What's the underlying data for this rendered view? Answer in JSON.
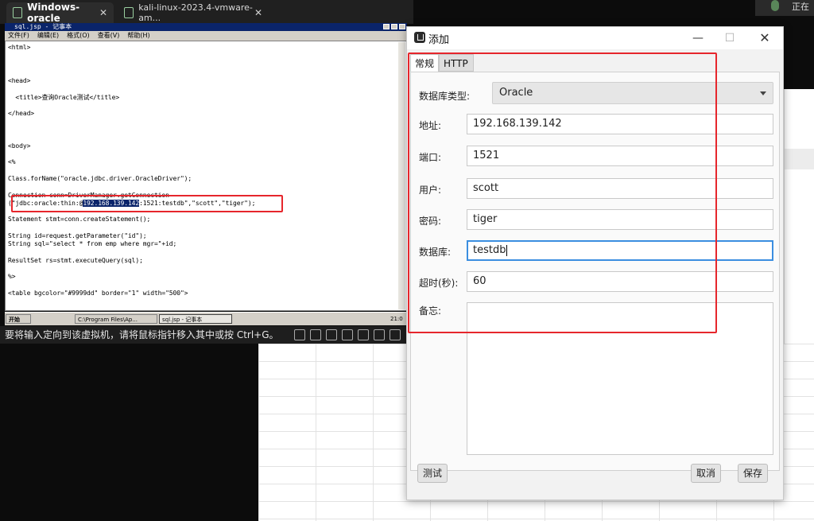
{
  "vm": {
    "tabs": [
      {
        "label": "Windows-oracle",
        "close": "✕"
      },
      {
        "label": "kali-linux-2023.4-vmware-am...",
        "close": "✕"
      }
    ],
    "status_text": "要将输入定向到该虚拟机，请将鼠标指针移入其中或按 Ctrl+G。",
    "top_right_text": "正在"
  },
  "notepad": {
    "title": "sql.jsp - 记事本",
    "menu": [
      "文件(F)",
      "编辑(E)",
      "格式(O)",
      "查看(V)",
      "帮助(H)"
    ],
    "lines": {
      "l1": "<html>",
      "l2": "<head>",
      "l3": "  <title>查询Oracle测试</title>",
      "l4": "</head>",
      "l5": "<body>",
      "l6": "<%",
      "l7": "Class.forName(\"oracle.jdbc.driver.OracleDriver\");",
      "l8": "Connection conn=DriverManager.getConnection",
      "l9a": "(\"jdbc:oracle:thin:@",
      "l9b": "192.168.139.142",
      "l9c": ":1521:testdb\",\"scott\",\"tiger\");",
      "l10": "Statement stmt=conn.createStatement();",
      "l11": "String id=request.getParameter(\"id\");",
      "l12": "String sql=\"select * from emp where mgr=\"+id;",
      "l13": "ResultSet rs=stmt.executeQuery(sql);",
      "l14": "%>",
      "l15": "<table bgcolor=\"#9999dd\" border=\"1\" width=\"500\">"
    }
  },
  "xp_taskbar": {
    "start": "开始",
    "item1": "C:\\Program Files\\Ap...",
    "item2": "sql.jsp - 记事本",
    "clock": "21:0"
  },
  "dialog": {
    "title": "添加",
    "controls": {
      "minimize": "—",
      "maximize": "☐",
      "close": "✕"
    },
    "tabs": [
      "常规",
      "HTTP"
    ],
    "fields": {
      "db_type_label": "数据库类型:",
      "db_type_value": "Oracle",
      "host_label": "地址:",
      "host_value": "192.168.139.142",
      "port_label": "端口:",
      "port_value": "1521",
      "user_label": "用户:",
      "user_value": "scott",
      "password_label": "密码:",
      "password_value": "tiger",
      "database_label": "数据库:",
      "database_value": "testdb",
      "timeout_label": "超时(秒):",
      "timeout_value": "60",
      "notes_label": "备忘:"
    },
    "buttons": {
      "test": "测试",
      "cancel": "取消",
      "save": "保存"
    }
  },
  "colors": {
    "annotation_red": "#e6262c",
    "focus_blue": "#3b8ee0",
    "selection_navy": "#0a246a"
  }
}
